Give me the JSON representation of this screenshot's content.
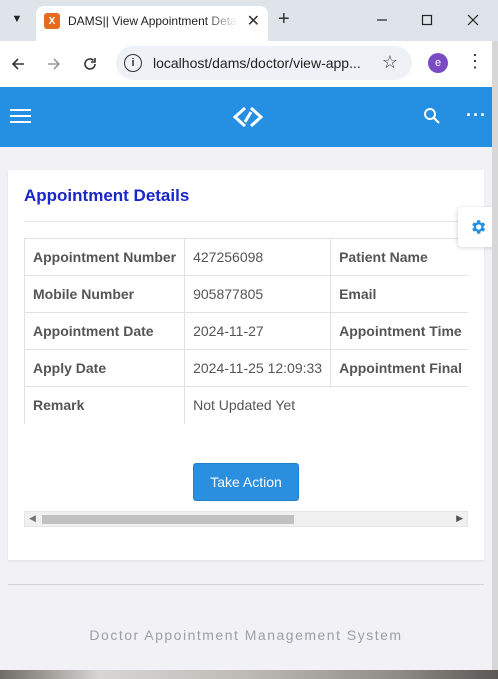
{
  "browser": {
    "tab_title": "DAMS|| View Appointment Details",
    "url": "localhost/dams/doctor/view-app...",
    "profile_initial": "e",
    "favicon_letter": "X",
    "accent": "#2590e1"
  },
  "page": {
    "title": "Appointment Details",
    "rows": [
      {
        "l1": "Appointment Number",
        "v1": "427256098",
        "l2": "Patient Name",
        "v2": ""
      },
      {
        "l1": "Mobile Number",
        "v1": "905877805",
        "l2": "Email",
        "v2": ""
      },
      {
        "l1": "Appointment Date",
        "v1": "2024-11-27",
        "l2": "Appointment Time",
        "v2": ""
      },
      {
        "l1": "Apply Date",
        "v1": "2024-11-25 12:09:33",
        "l2": "Appointment Final",
        "v2": ""
      },
      {
        "l1": "Remark",
        "v1": "Not Updated Yet"
      }
    ],
    "action_label": "Take Action"
  },
  "footer": {
    "text": "Doctor Appointment Management System"
  }
}
